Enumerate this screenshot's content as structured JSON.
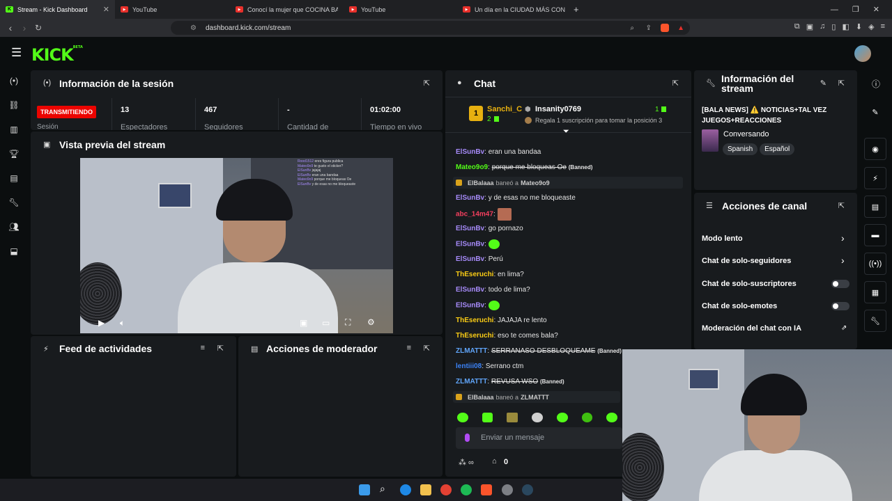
{
  "browser": {
    "tabs": [
      {
        "title": "Stream - Kick Dashboard",
        "active": true
      },
      {
        "title": "YouTube"
      },
      {
        "title": "Conocí la mujer que COCINA BASURA"
      },
      {
        "title": "YouTube"
      },
      {
        "title": "Un día en la CIUDAD MÁS CONTAMI"
      }
    ],
    "new_tab": "+",
    "url": "dashboard.kick.com/stream"
  },
  "header": {
    "logo": "KICK",
    "logo_badge": "BETA"
  },
  "session": {
    "title": "Información de la sesión",
    "status": "TRANSMITIENDO",
    "status_label": "Sesión",
    "stats": [
      {
        "value": "13",
        "label": "Espectadores"
      },
      {
        "value": "467",
        "label": "Seguidores"
      },
      {
        "value": "-",
        "label": "Cantidad de"
      },
      {
        "value": "01:02:00",
        "label": "Tiempo en vivo"
      }
    ]
  },
  "preview": {
    "title": "Vista previa del stream",
    "overlay_chat": [
      {
        "user": "Rood1512",
        "text": "eres figura publica"
      },
      {
        "user": "Mateo9o9",
        "text": "te gusto el sticker?"
      },
      {
        "user": "ElSunBv",
        "text": "jajajaj"
      },
      {
        "user": "ElSunBv",
        "text": "eran una bandaa"
      },
      {
        "user": "Mateo9o9",
        "text": "porque me bloqueas Oe"
      },
      {
        "user": "ElSunBv",
        "text": "y de esas no me bloqueaste"
      }
    ]
  },
  "feed": {
    "title": "Feed de actividades"
  },
  "mod_actions": {
    "title": "Acciones de moderador"
  },
  "chat": {
    "title": "Chat",
    "top_gifter": {
      "name": "Sanchi_C",
      "count": "2"
    },
    "second": {
      "name": "Insanity0769",
      "count": "1"
    },
    "cta": "Regala 1 suscripción para tomar la posición 3",
    "messages": [
      {
        "user": "ElSunBv",
        "text": "eran una bandaa",
        "color": "#a78bfa"
      },
      {
        "user": "Mateo9o9",
        "text": "porque me bloqueas Oe",
        "banned": "(Banned)",
        "color": "#53fc18"
      },
      {
        "mod": "ElBalaaa",
        "action": "baneó a",
        "target": "Mateo9o9"
      },
      {
        "user": "ElSunBv",
        "text": "y de esas no me bloqueaste",
        "color": "#a78bfa"
      },
      {
        "user": "abc_14m47",
        "text": "",
        "color": "#f43f5e"
      },
      {
        "user": "ElSunBv",
        "text": "go pornazo",
        "color": "#a78bfa"
      },
      {
        "user": "ElSunBv",
        "text": "",
        "color": "#a78bfa"
      },
      {
        "user": "ElSunBv",
        "text": "Perú",
        "color": "#a78bfa"
      },
      {
        "user": "ThEseruchi",
        "text": "en lima?",
        "color": "#facc15"
      },
      {
        "user": "ElSunBv",
        "text": "todo de lima?",
        "color": "#a78bfa"
      },
      {
        "user": "ElSunBv",
        "text": "",
        "color": "#a78bfa"
      },
      {
        "user": "ThEseruchi",
        "text": "JAJAJA re lento",
        "color": "#facc15"
      },
      {
        "user": "ThEseruchi",
        "text": "eso te comes bala?",
        "color": "#facc15"
      },
      {
        "user": "ZLMATTT",
        "text": "SERRANASO DESBLOQUEAME",
        "banned": "(Banned)",
        "color": "#60a5fa"
      },
      {
        "user": "lentiii08",
        "text": "Serrano ctm",
        "color": "#3b82f6"
      },
      {
        "user": "ZLMATTT",
        "text": "REVUSA WSO",
        "banned": "(Banned)",
        "color": "#60a5fa"
      },
      {
        "mod": "ElBalaaa",
        "action": "baneó a",
        "target": "ZLMATTT"
      }
    ],
    "input_placeholder": "Enviar un mensaje",
    "points": "0"
  },
  "stream_info": {
    "title": "Información del stream",
    "stream_title": "[BALA NEWS] ⚠️ NOTICIAS+TAL VEZ JUEGOS+REACCIONES",
    "category": "Conversando",
    "tags": [
      "Spanish",
      "Español"
    ]
  },
  "channel_actions": {
    "title": "Acciones de canal",
    "items": [
      {
        "label": "Modo lento",
        "control": "chevron"
      },
      {
        "label": "Chat de solo-seguidores",
        "control": "chevron"
      },
      {
        "label": "Chat de solo-suscriptores",
        "control": "toggle",
        "on": false
      },
      {
        "label": "Chat de solo-emotes",
        "control": "toggle",
        "on": false
      },
      {
        "label": "Moderación del chat con IA",
        "control": "external"
      }
    ]
  },
  "colors": {
    "accent": "#53fc18",
    "live": "#eb0400",
    "panel": "#181b1e"
  }
}
